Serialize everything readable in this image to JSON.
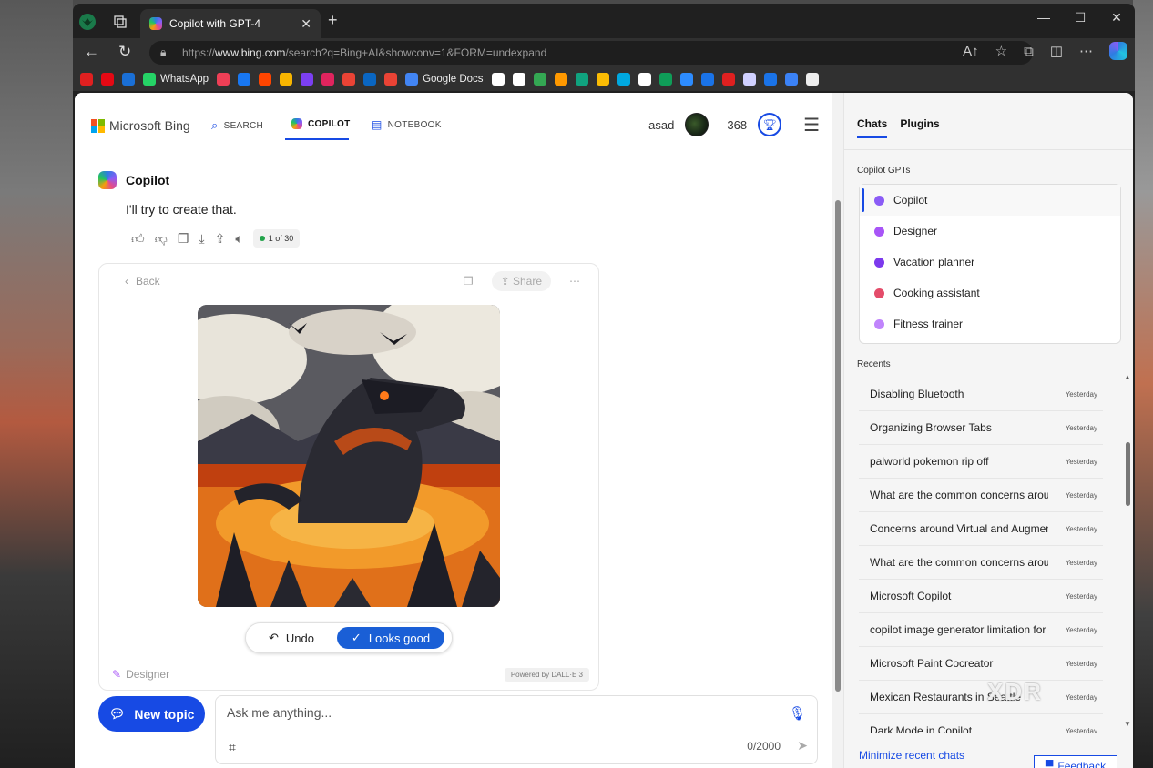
{
  "browser": {
    "tab_title": "Copilot with GPT-4",
    "url_prefix": "https://",
    "url_host": "www.bing.com",
    "url_path": "/search?q=Bing+AI&showconv=1&FORM=undexpand",
    "bookmarks": [
      {
        "label": "",
        "color": "#e02020"
      },
      {
        "label": "",
        "color": "#e50914"
      },
      {
        "label": "",
        "color": "#1a6fd6"
      },
      {
        "label": "WhatsApp",
        "color": "#25d366"
      },
      {
        "label": "",
        "color": "#ef3f56"
      },
      {
        "label": "",
        "color": "#1877f2"
      },
      {
        "label": "",
        "color": "#ff4500"
      },
      {
        "label": "",
        "color": "#f7b500"
      },
      {
        "label": "",
        "color": "#7b3ff2"
      },
      {
        "label": "",
        "color": "#e0245e"
      },
      {
        "label": "",
        "color": "#ea4335"
      },
      {
        "label": "",
        "color": "#0a66c2"
      },
      {
        "label": "",
        "color": "#ea4335"
      },
      {
        "label": "Google Docs",
        "color": "#4285f4"
      },
      {
        "label": "",
        "color": "#ffffff"
      },
      {
        "label": "",
        "color": "#ffffff"
      },
      {
        "label": "",
        "color": "#34a853"
      },
      {
        "label": "",
        "color": "#ff9900"
      },
      {
        "label": "",
        "color": "#10a37f"
      },
      {
        "label": "",
        "color": "#fbbc04"
      },
      {
        "label": "",
        "color": "#00a8e0"
      },
      {
        "label": "",
        "color": "#ffffff"
      },
      {
        "label": "",
        "color": "#0f9d58"
      },
      {
        "label": "",
        "color": "#2d8cff"
      },
      {
        "label": "",
        "color": "#1a73e8"
      },
      {
        "label": "",
        "color": "#e02020"
      },
      {
        "label": "",
        "color": "#d0d0ff"
      },
      {
        "label": "",
        "color": "#1a73e8"
      },
      {
        "label": "",
        "color": "#3b82f6"
      },
      {
        "label": "",
        "color": "#eeeeee"
      }
    ]
  },
  "header": {
    "logo_text": "Microsoft Bing",
    "nav": [
      {
        "label": "SEARCH"
      },
      {
        "label": "COPILOT"
      },
      {
        "label": "NOTEBOOK"
      }
    ],
    "user_name": "asad",
    "points": "368"
  },
  "conversation": {
    "author": "Copilot",
    "message": "I'll try to create that.",
    "response_counter": "1 of 30"
  },
  "image_card": {
    "back_label": "Back",
    "share_label": "Share",
    "undo_label": "Undo",
    "looks_good_label": "Looks good",
    "designer_label": "Designer",
    "powered_by": "Powered by DALL·E 3"
  },
  "composer": {
    "new_topic_label": "New topic",
    "placeholder": "Ask me anything...",
    "char_count": "0/2000"
  },
  "sidebar": {
    "tabs": [
      {
        "label": "Chats"
      },
      {
        "label": "Plugins"
      }
    ],
    "gpts_heading": "Copilot GPTs",
    "gpts": [
      {
        "label": "Copilot",
        "color": "#8b5cf6"
      },
      {
        "label": "Designer",
        "color": "#a855f7"
      },
      {
        "label": "Vacation planner",
        "color": "#7c3aed"
      },
      {
        "label": "Cooking assistant",
        "color": "#e44c6a"
      },
      {
        "label": "Fitness trainer",
        "color": "#c084fc"
      }
    ],
    "recents_heading": "Recents",
    "recents": [
      {
        "title": "Disabling Bluetooth",
        "when": "Yesterday"
      },
      {
        "title": "Organizing Browser Tabs",
        "when": "Yesterday"
      },
      {
        "title": "palworld pokemon rip off",
        "when": "Yesterday"
      },
      {
        "title": "What are the common concerns around",
        "when": "Yesterday"
      },
      {
        "title": "Concerns around Virtual and Augmented",
        "when": "Yesterday"
      },
      {
        "title": "What are the common concerns around",
        "when": "Yesterday"
      },
      {
        "title": "Microsoft Copilot",
        "when": "Yesterday"
      },
      {
        "title": "copilot image generator limitation for",
        "when": "Yesterday"
      },
      {
        "title": "Microsoft Paint Cocreator",
        "when": "Yesterday"
      },
      {
        "title": "Mexican Restaurants in Seattle",
        "when": "Yesterday"
      },
      {
        "title": "Dark Mode in Copilot",
        "when": "Yesterday"
      }
    ],
    "minimize_label": "Minimize recent chats",
    "feedback_label": "Feedback"
  },
  "watermark": "XDR"
}
